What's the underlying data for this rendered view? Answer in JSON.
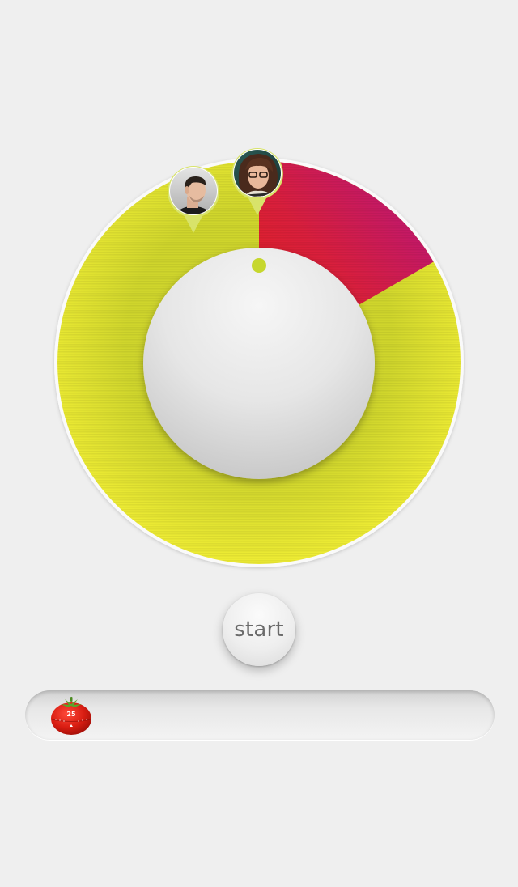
{
  "timer": {
    "segments": [
      {
        "name": "yellow-segment",
        "from_deg": 0,
        "to_deg": 360,
        "color": "#dede30"
      },
      {
        "name": "red-magenta-segment",
        "from_deg": 0,
        "to_deg": 60,
        "colors": [
          "#e02a1a",
          "#d01a5c",
          "#c0147a"
        ]
      }
    ],
    "indicator_color": "#c6d72e",
    "participants": [
      {
        "id": "man",
        "avatar": "man-avatar-icon",
        "pin_color": "#d8e36a",
        "position_deg": -13
      },
      {
        "id": "woman",
        "avatar": "woman-avatar-icon",
        "pin_color": "#d8e36a",
        "position_deg": 0
      }
    ]
  },
  "controls": {
    "start_label": "start"
  },
  "tray": {
    "items": [
      {
        "icon": "tomato-timer-icon",
        "label": "25",
        "color": "#d81d12"
      }
    ]
  }
}
